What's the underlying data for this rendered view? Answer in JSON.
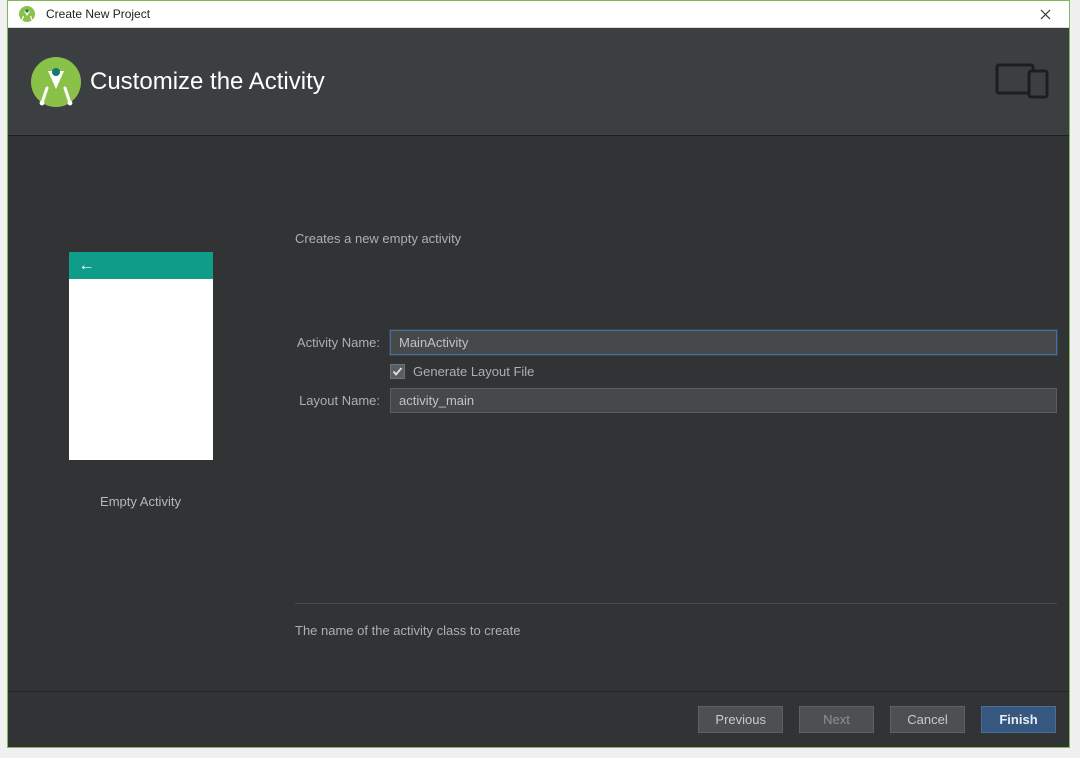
{
  "window": {
    "title": "Create New Project"
  },
  "header": {
    "title": "Customize the Activity"
  },
  "left": {
    "preview_label": "Empty Activity"
  },
  "form": {
    "description": "Creates a new empty activity",
    "activity_name_label": "Activity Name:",
    "activity_name_value": "MainActivity",
    "generate_layout_label": "Generate Layout File",
    "generate_layout_checked": true,
    "layout_name_label": "Layout Name:",
    "layout_name_value": "activity_main",
    "hint": "The name of the activity class to create"
  },
  "footer": {
    "previous": "Previous",
    "next": "Next",
    "cancel": "Cancel",
    "finish": "Finish"
  }
}
